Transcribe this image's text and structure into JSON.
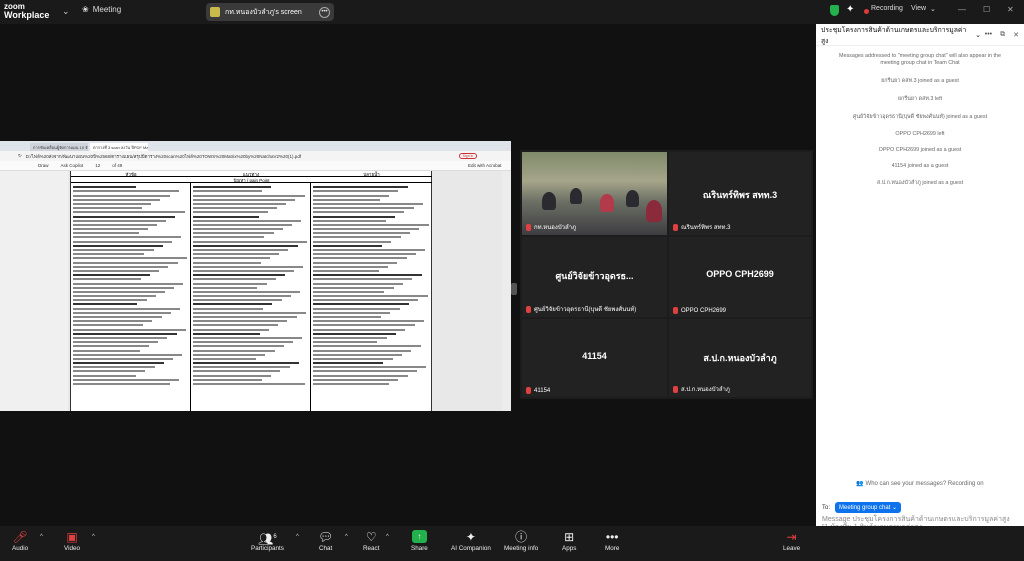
{
  "app": {
    "logo_line1": "zoom",
    "logo_line2": "Workplace",
    "meeting_label": "Meeting"
  },
  "share": {
    "label": "กท.หนองบัวลำภู's screen"
  },
  "status": {
    "recording": "Recording",
    "view": "View"
  },
  "browser": {
    "tabs": [
      "การขับเคลื่อนผู้จัดการแผน 10 จังห",
      "ตารางที่ 3 scan ลงวัน ปีPDF Matrix"
    ],
    "url": "D:/ไฟล์%20ส่งจาก/พัฒนาแผน%20ปี%2568/ตารางแผน/สรุปปีตาราง%20scan%20ไฟล์%20TOWS%20Matrix%20by%20NatchaV2%20(1).pdf",
    "signin": "Sign in",
    "toolbar": [
      "Draw",
      "Ask Copilot",
      "12",
      "of 49"
    ],
    "toolbar_right": "Edit with Acrobat",
    "table_headers": [
      "หัวข้อ",
      "แนวทาง",
      "ปลายน้ำ"
    ],
    "table_subheader": "ปัญหา / pain Point"
  },
  "participants": [
    {
      "name": "กท.หนองบัวลำภู",
      "display": ""
    },
    {
      "name": "ณรินทร์ทิพร สทท.3",
      "display": "ณรินทร์ทิพร สทท.3"
    },
    {
      "name": "ศูนย์วิจัยข้าวอุดรธานี(บุษดี ชัยพงศ์นนท์)",
      "display": "ศูนย์วิจัยข้าวอุดรธ..."
    },
    {
      "name": "OPPO CPH2699",
      "display": "OPPO CPH2699"
    },
    {
      "name": "41154",
      "display": "41154"
    },
    {
      "name": "ส.ป.ก.หนองบัวลำภู",
      "display": "ส.ป.ก.หนองบัวลำภู"
    }
  ],
  "chat": {
    "title": "ประชุมโครงการสินค้าด้านเกษตรและบริการมูลค่าสูง",
    "notice": "Messages addressed to \"meeting group chat\" will also appear in the meeting group chat in Team Chat",
    "messages": [
      "ยกรีนยา ดสท.3 joined as a guest",
      "ยกรีนยา ดสท.3 left",
      "ศูนย์วิจัยข้าวอุดรธานี(บุษดี ชัยพงศ์นนท์) joined as a guest",
      "OPPO CPH2699 left",
      "OPPO CPH2699 joined as a guest",
      "41154 joined as a guest",
      "ส.ป.ก.หนองบัวลำภู joined as a guest"
    ],
    "visibility": "Who can see your messages? Recording on",
    "to_label": "To:",
    "to_value": "Meeting group chat",
    "input": "Message ประชุมโครงการสินค้าด้านเกษตรและบริการมูลค่าสูง \"1 ห้องที่ม 1 สินค้าเกษตรมูลค่าสูง"
  },
  "controls": [
    {
      "label": "Audio",
      "icon": "mic-muted-icon"
    },
    {
      "label": "Video",
      "icon": "video-off-icon"
    },
    {
      "label": "Participants",
      "icon": "participants-icon",
      "count": "6"
    },
    {
      "label": "Chat",
      "icon": "chat-icon"
    },
    {
      "label": "React",
      "icon": "react-icon"
    },
    {
      "label": "Share",
      "icon": "share-icon"
    },
    {
      "label": "AI Companion",
      "icon": "ai-companion-icon"
    },
    {
      "label": "Meeting info",
      "icon": "info-icon"
    },
    {
      "label": "Apps",
      "icon": "apps-icon"
    },
    {
      "label": "More",
      "icon": "more-icon"
    },
    {
      "label": "Leave",
      "icon": "leave-icon"
    }
  ],
  "colors": {
    "accent": "#0e72ed",
    "share_green": "#22b14c",
    "recording_red": "#e03a3a",
    "speaker_highlight": "#2ecc40"
  }
}
